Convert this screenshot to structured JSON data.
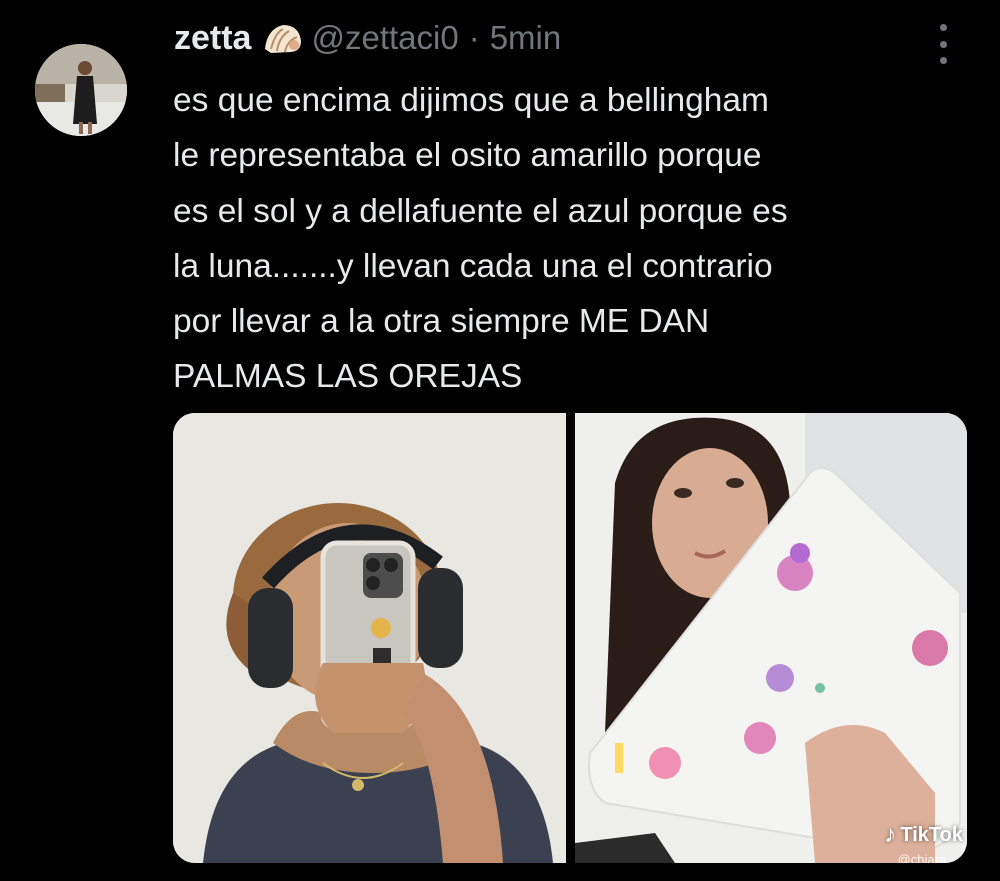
{
  "author": {
    "name": "zetta",
    "handle": "@zettaci0",
    "separator": "·",
    "time": "5min",
    "badge_icon": "shell-icon"
  },
  "tweet": {
    "lines": [
      "es que encima dijimos que a bellingham",
      "le representaba el osito amarillo porque",
      "es el sol y a dellafuente el azul porque es",
      "la luna.......y llevan cada una el contrario",
      "por llevar a la otra siempre ME DAN",
      "PALMAS LAS OREJAS"
    ]
  },
  "media": {
    "watermark": "TikTok",
    "watermark_handle": "@chiara..."
  },
  "colors": {
    "background": "#000000",
    "primary_text": "#e7e9ea",
    "secondary_text": "#71767b"
  }
}
